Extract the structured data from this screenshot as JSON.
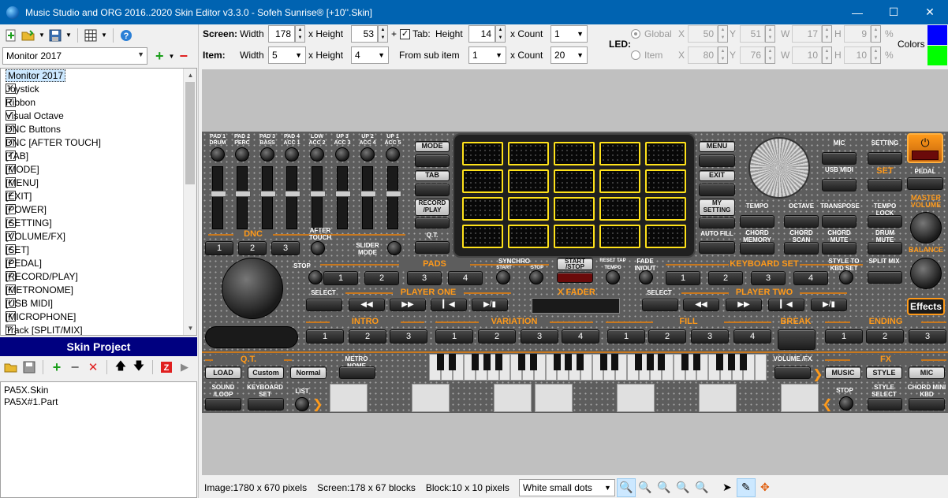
{
  "window": {
    "title": "Music Studio and ORG 2016..2020 Skin Editor v3.3.0 - Sofeh Sunrise® [+10''.Skin]",
    "min": "—",
    "max": "☐",
    "close": "✕"
  },
  "toolbar": {
    "new_icon": "new-file-icon",
    "open_icon": "open-folder-icon",
    "save_icon": "save-icon",
    "grid_icon": "grid-icon",
    "help_icon": "help-icon"
  },
  "skin_select": {
    "value": "Monitor 2017",
    "add": "+",
    "remove": "−"
  },
  "layers": [
    {
      "label": "Monitor 2017",
      "checked": true,
      "selected": true
    },
    {
      "label": "Joystick",
      "checked": true
    },
    {
      "label": "Ribbon",
      "checked": true
    },
    {
      "label": "Visual Octave",
      "checked": true
    },
    {
      "label": "DNC Buttons",
      "checked": true
    },
    {
      "label": "DNC [AFTER TOUCH]",
      "checked": true
    },
    {
      "label": "[TAB]",
      "checked": true
    },
    {
      "label": "[MODE]",
      "checked": true
    },
    {
      "label": "[MENU]",
      "checked": true
    },
    {
      "label": "[EXIT]",
      "checked": true
    },
    {
      "label": "[POWER]",
      "checked": true
    },
    {
      "label": "[SETTING]",
      "checked": true
    },
    {
      "label": "[VOLUME/FX]",
      "checked": true
    },
    {
      "label": "[SET]",
      "checked": true
    },
    {
      "label": "[PEDAL]",
      "checked": true
    },
    {
      "label": "[RECORD/PLAY]",
      "checked": true
    },
    {
      "label": "[METRONOME]",
      "checked": true
    },
    {
      "label": "[USB MIDI]",
      "checked": true
    },
    {
      "label": "[MICROPHONE]",
      "checked": true
    },
    {
      "label": "Track [SPLIT/MIX]",
      "checked": true
    }
  ],
  "project": {
    "header": "Skin Project",
    "files": [
      "PA5X.Skin",
      "PA5X#1.Part"
    ]
  },
  "screen": {
    "label": "Screen:",
    "width_label": "Width",
    "width": "178",
    "x_height": "x Height",
    "height": "53",
    "plus": "+",
    "tab_label": "Tab:",
    "tab_checked": true,
    "tab_height_label": "Height",
    "tab_height": "14",
    "x_count": "x Count",
    "count": "1"
  },
  "item": {
    "label": "Item:",
    "width_label": "Width",
    "width": "5",
    "x_height": "x Height",
    "height": "4",
    "from_sub": "From sub item",
    "sub": "1",
    "x_count": "x Count",
    "count": "20"
  },
  "led": {
    "label": "LED:",
    "global": "Global",
    "item": "Item",
    "global_vals": {
      "x": "50",
      "y": "51",
      "w": "17",
      "h": "9"
    },
    "item_vals": {
      "x": "80",
      "y": "76",
      "w": "10",
      "h": "10"
    },
    "x": "X",
    "y": "Y",
    "w": "W",
    "h": "H",
    "pct": "%",
    "colors": "Colors",
    "color1": "#0000ff",
    "color2": "#00ff00"
  },
  "skin": {
    "dnc": [
      "PAD 1 DRUM",
      "PAD 2 PERC",
      "PAD 3 BASS",
      "PAD 4 ACC 1",
      "LOW ACC 2",
      "UP 3 ACC 3",
      "UP 2 ACC 4",
      "UP 1 ACC 5"
    ],
    "dnc_label": "DNC",
    "after_touch": "AFTER TOUCH",
    "slider_mode": "SLIDER MODE",
    "dnc_buttons": [
      "1",
      "2",
      "3"
    ],
    "mode": "MODE",
    "tab": "TAB",
    "record_play": "RECORD /PLAY",
    "qt_small": "Q.T.",
    "menu": "MENU",
    "exit": "EXIT",
    "my_setting": "MY SETTING",
    "auto_fill": "AUTO FILL",
    "mic": "MIC",
    "setting": "SETTING",
    "usb_midi": "USB MIDI",
    "set": "SET",
    "pedal": "PEDAL",
    "tempo": "TEMPO",
    "octave": "OCTAVE",
    "transpose": "TRANSPOSE",
    "tempo_lock": "TEMPO LOCK",
    "chord_memory": "CHORD MEMORY",
    "chord_scan": "CHORD SCAN",
    "chord_mute": "CHORD MUTE",
    "drum_mute": "DRUM MUTE",
    "master_volume": "MASTER VOLUME",
    "balance": "BALANCE",
    "effects": "Effects",
    "split_mix": "SPLIT MIX",
    "pads": "PADS",
    "pad_buttons": [
      "1",
      "2",
      "3",
      "4"
    ],
    "stop": "STOP",
    "synchro": "SYNCHRO",
    "start": "START",
    "synchro_stop": "STOP",
    "start_stop": "START /STOP",
    "reset": "RESET TAP TEMPO",
    "fade": "FADE IN/OUT",
    "keyboard_set": "KEYBOARD SET",
    "kbd_buttons": [
      "1",
      "2",
      "3",
      "4"
    ],
    "style_to_kbd": "STYLE TO KBD SET",
    "select": "SELECT",
    "player_one": "PLAYER ONE",
    "x_fader": "X FADER",
    "player_two": "PLAYER TWO",
    "transport": [
      "◀◀",
      "▶▶",
      "▎◀",
      "▶/▮"
    ],
    "intro": "INTRO",
    "variation": "VARIATION",
    "fill": "FILL",
    "break": "BREAK",
    "ending": "ENDING",
    "intro_buttons": [
      "1",
      "2",
      "3"
    ],
    "variation_buttons": [
      "1",
      "2",
      "3",
      "4"
    ],
    "fill_buttons": [
      "1",
      "2",
      "3",
      "4"
    ],
    "ending_buttons": [
      "1",
      "2",
      "3"
    ],
    "qt": "Q.T.",
    "load": "LOAD",
    "custom": "Custom",
    "normal": "Normal",
    "metronome": "METRO NOME",
    "sound_loop": "SOUND /LOOP",
    "keyboard_set_btn": "KEYBOARD SET",
    "list": "LIST",
    "volume_fx": "VOLUME /FX",
    "fx": "FX",
    "music": "MUSIC",
    "style": "STYLE",
    "mic_btn": "MIC",
    "stop2": "STOP",
    "style_select": "STYLE SELECT",
    "chord_mini_kbd": "CHORD MINI KBD"
  },
  "status": {
    "image": "Image:1780 x 670 pixels",
    "screen": "Screen:178 x 67 blocks",
    "block": "Block:10 x 10 pixels",
    "grid_style": "White small dots"
  }
}
